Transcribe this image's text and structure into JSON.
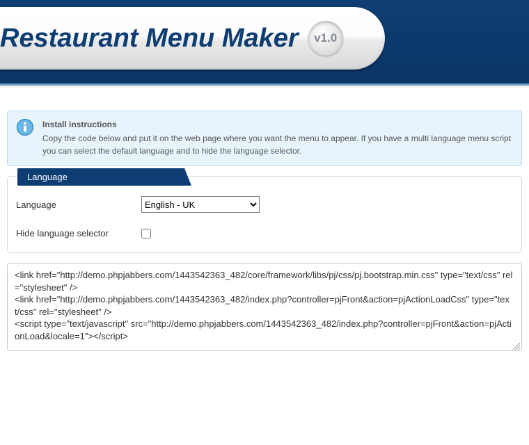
{
  "header": {
    "title": "Restaurant Menu Maker",
    "version": "v1.0"
  },
  "info": {
    "title": "Install instructions",
    "body": "Copy the code below and put it on the web page where you want the menu to appear. If you have a multi language menu script you can select the default language and to hide the language selector."
  },
  "panel": {
    "legend": "Language",
    "language_label": "Language",
    "language_value": "English - UK",
    "hide_label": "Hide language selector",
    "hide_checked": false
  },
  "code": "<link href=\"http://demo.phpjabbers.com/1443542363_482/core/framework/libs/pj/css/pj.bootstrap.min.css\" type=\"text/css\" rel=\"stylesheet\" />\n<link href=\"http://demo.phpjabbers.com/1443542363_482/index.php?controller=pjFront&action=pjActionLoadCss\" type=\"text/css\" rel=\"stylesheet\" />\n<script type=\"text/javascript\" src=\"http://demo.phpjabbers.com/1443542363_482/index.php?controller=pjFront&action=pjActionLoad&locale=1\"></script>"
}
